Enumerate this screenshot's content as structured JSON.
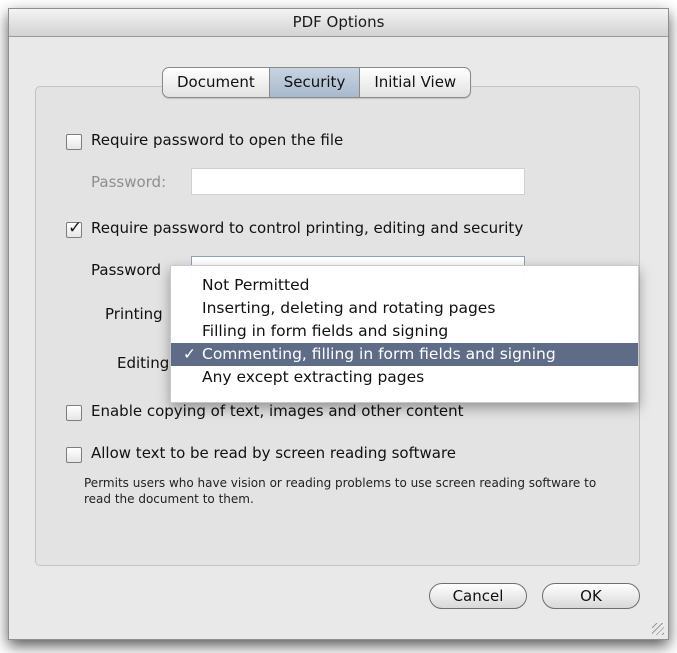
{
  "window": {
    "title": "PDF Options"
  },
  "tabs": [
    {
      "label": "Document",
      "active": false
    },
    {
      "label": "Security",
      "active": true
    },
    {
      "label": "Initial View",
      "active": false
    }
  ],
  "open_password": {
    "label": "Require password to open the file",
    "checked": false,
    "password_label": "Password:",
    "password_value": ""
  },
  "permissions_password": {
    "label": "Require password to control printing, editing and security",
    "checked": true,
    "password_label": "Password",
    "printing_label": "Printing",
    "editing_label": "Editing"
  },
  "editing_menu": {
    "items": [
      "Not Permitted",
      "Inserting, deleting and rotating pages",
      "Filling in form fields and signing",
      "Commenting, filling in form fields and signing",
      "Any except extracting pages"
    ],
    "selected": "Commenting, filling in form fields and signing",
    "check_glyph": "✓"
  },
  "copy_content": {
    "label": "Enable copying of text, images and other content",
    "checked": false
  },
  "screen_reader": {
    "label": "Allow text to be read by screen reading software",
    "checked": false,
    "note": "Permits users who have vision or reading problems to use screen reading software to read the document to them."
  },
  "buttons": {
    "cancel": "Cancel",
    "ok": "OK"
  },
  "colors": {
    "menu_highlight": "#5f6c87",
    "tab_active": "#b8c6d8",
    "window_bg": "#e9e9e9"
  }
}
